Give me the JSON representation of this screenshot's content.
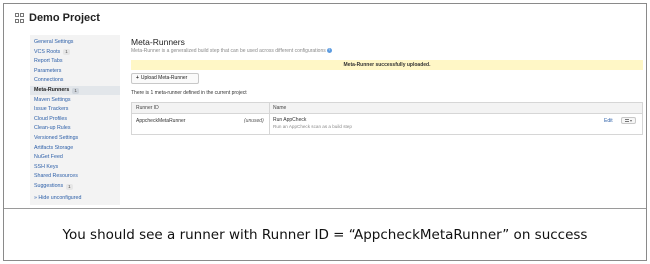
{
  "project": {
    "title": "Demo Project"
  },
  "sidebar": {
    "items": [
      {
        "label": "General Settings",
        "badge": ""
      },
      {
        "label": "VCS Roots",
        "badge": "1"
      },
      {
        "label": "Report Tabs",
        "badge": ""
      },
      {
        "label": "Parameters",
        "badge": ""
      },
      {
        "label": "Connections",
        "badge": ""
      },
      {
        "label": "Meta-Runners",
        "badge": "1"
      },
      {
        "label": "Maven Settings",
        "badge": ""
      },
      {
        "label": "Issue Trackers",
        "badge": ""
      },
      {
        "label": "Cloud Profiles",
        "badge": ""
      },
      {
        "label": "Clean-up Rules",
        "badge": ""
      },
      {
        "label": "Versioned Settings",
        "badge": ""
      },
      {
        "label": "Artifacts Storage",
        "badge": ""
      },
      {
        "label": "NuGet Feed",
        "badge": ""
      },
      {
        "label": "SSH Keys",
        "badge": ""
      },
      {
        "label": "Shared Resources",
        "badge": ""
      },
      {
        "label": "Suggestions",
        "badge": "1"
      },
      {
        "label": "» Hide unconfigured",
        "badge": ""
      }
    ],
    "active_index": 5
  },
  "main": {
    "title": "Meta-Runners",
    "description": "Meta-Runner is a generalized build step that can be used across different configurations",
    "help_icon": "?",
    "notice": "Meta-Runner successfully uploaded.",
    "upload_button": {
      "icon": "+",
      "label": "Upload Meta-Runner"
    },
    "count_text": "There is 1 meta-runner defined in the current project",
    "table": {
      "headers": [
        "Runner ID",
        "Name"
      ],
      "rows": [
        {
          "runner_id": "AppcheckMetaRunner",
          "status": "(unused)",
          "name": "Run AppCheck",
          "description": "Run an AppCheck scan as a build step",
          "edit_label": "Edit"
        }
      ]
    }
  },
  "caption": "You should see a runner with Runner ID = “AppcheckMetaRunner” on success",
  "colors": {
    "link": "#2b5ea8",
    "notice_bg": "#fff7c6",
    "sidebar_bg": "#f3f3f3",
    "sidebar_active_bg": "#e2e6ea"
  }
}
